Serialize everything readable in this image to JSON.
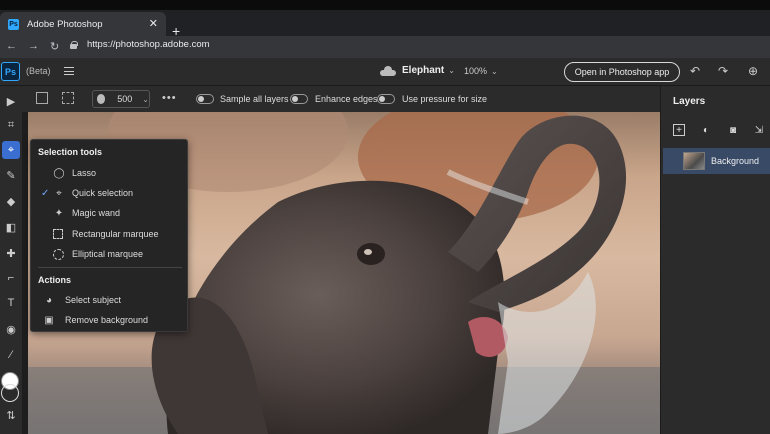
{
  "browser": {
    "tab_title": "Adobe Photoshop",
    "tab_close": "✕",
    "new_tab": "+",
    "url": "https://photoshop.adobe.com",
    "icons": [
      "back-icon",
      "forward-icon",
      "reload-icon",
      "lock-icon"
    ]
  },
  "header": {
    "logo": "Ps",
    "beta": "(Beta)",
    "document_name": "Elephant",
    "zoom": "100%",
    "open_app_button": "Open in Photoshop app",
    "icons": [
      "menu-icon",
      "cloud-icon",
      "undo-icon",
      "redo-icon",
      "share-icon"
    ]
  },
  "options": {
    "brush_size": "500",
    "more": "•••",
    "sample_all_layers": "Sample all layers",
    "enhance_edges": "Enhance edges",
    "use_pressure": "Use pressure for size"
  },
  "selection_menu": {
    "section_tools": "Selection tools",
    "tools": [
      {
        "label": "Lasso",
        "checked": false,
        "icon": "lasso-icon"
      },
      {
        "label": "Quick selection",
        "checked": true,
        "icon": "quick-selection-icon"
      },
      {
        "label": "Magic wand",
        "checked": false,
        "icon": "magic-wand-icon"
      },
      {
        "label": "Rectangular marquee",
        "checked": false,
        "icon": "rectangular-marquee-icon"
      },
      {
        "label": "Elliptical marquee",
        "checked": false,
        "icon": "elliptical-marquee-icon"
      }
    ],
    "section_actions": "Actions",
    "actions": [
      {
        "label": "Select subject",
        "icon": "select-subject-icon"
      },
      {
        "label": "Remove background",
        "icon": "remove-background-icon"
      }
    ]
  },
  "layers": {
    "title": "Layers",
    "items": [
      {
        "name": "Background"
      }
    ]
  },
  "colors": {
    "accent": "#3b6ed1",
    "ps_blue": "#31a8ff",
    "selected_layer": "#394a66"
  }
}
